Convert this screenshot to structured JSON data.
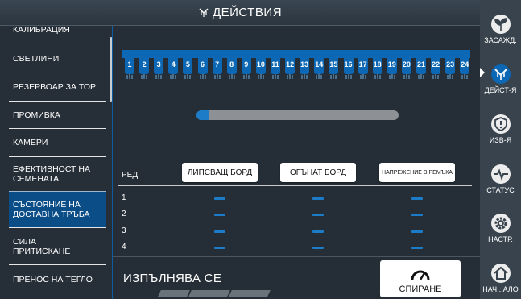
{
  "title": "ДЕЙСТВИЯ",
  "left_menu": {
    "items": [
      {
        "label": "КАЛИБРАЦИЯ"
      },
      {
        "label": "СВЕТЛИНИ"
      },
      {
        "label": "РЕЗЕРВОАР ЗА ТОР"
      },
      {
        "label": "ПРОМИВКА"
      },
      {
        "label": "КАМЕРИ"
      },
      {
        "label": "ЕФЕКТИВНОСТ НА\nСЕМЕНАТА"
      },
      {
        "label": "СЪСТОЯНИЕ НА\nДОСТАВНА ТРЪБА"
      },
      {
        "label": "СИЛА\nПРИТИСКАНЕ"
      },
      {
        "label": "ПРЕНОС НА ТЕГЛО"
      }
    ],
    "active_index": 6
  },
  "rows": [
    "1",
    "2",
    "3",
    "4",
    "5",
    "6",
    "7",
    "8",
    "9",
    "10",
    "11",
    "12",
    "13",
    "14",
    "15",
    "16",
    "17",
    "18",
    "19",
    "20",
    "21",
    "22",
    "23",
    "24"
  ],
  "progress": {
    "fraction": 0.06
  },
  "table": {
    "row_header": "РЕД",
    "columns": [
      "ЛИПСВАЩ БОРД",
      "ОГЪНАТ БОРД",
      "НАПРЕЖЕНИЕ В РЕМЪКА"
    ],
    "row_labels": [
      "1",
      "2",
      "3",
      "4"
    ],
    "cells": [
      [
        "—",
        "—",
        "—"
      ],
      [
        "—",
        "—",
        "—"
      ],
      [
        "—",
        "—",
        "—"
      ],
      [
        "—",
        "—",
        "—"
      ]
    ]
  },
  "status": {
    "text": "ИЗПЪЛНЯВА СЕ"
  },
  "stop_button": {
    "label": "СПИРАНЕ",
    "icon": "gauge-icon"
  },
  "right_nav": {
    "items": [
      {
        "label": "ЗАСАЖД.",
        "icon": "sprout-icon"
      },
      {
        "label": "ДЕЙСТ-Я",
        "icon": "planter-icon"
      },
      {
        "label": "ИЗВ-Я",
        "icon": "warning-shield-icon"
      },
      {
        "label": "СТАТУС",
        "icon": "pulse-icon"
      },
      {
        "label": "НАСТР.",
        "icon": "gear-icon"
      },
      {
        "label": "НАЧ...АЛО",
        "icon": "home-icon"
      }
    ],
    "active_index": 1
  },
  "colors": {
    "accent": "#0c67b4",
    "active_menu": "#0a4d87",
    "background": "#252e36"
  }
}
